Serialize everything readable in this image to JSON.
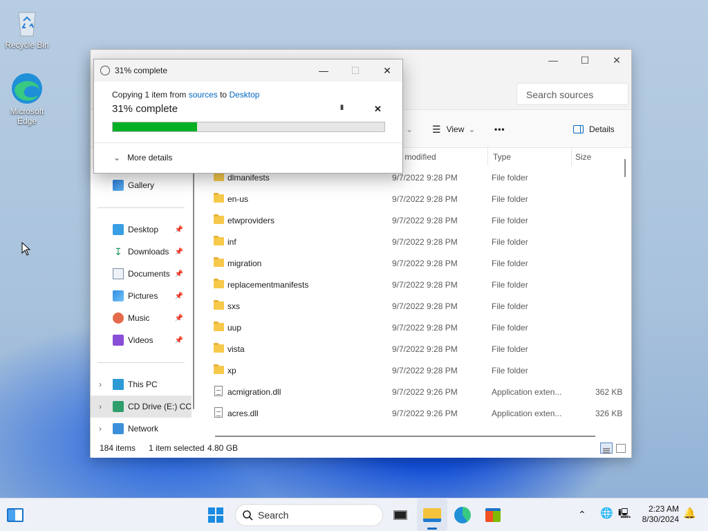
{
  "desktop": {
    "icons": [
      {
        "label": "Recycle Bin",
        "icon": "recycle-bin-icon"
      },
      {
        "label": "Microsoft Edge",
        "icon": "edge-icon"
      }
    ]
  },
  "explorer": {
    "search_placeholder": "Search sources",
    "toolbar": {
      "view_label": "View",
      "more_label": "•••",
      "details_label": "Details"
    },
    "columns": [
      "te modified",
      "Type",
      "Size"
    ],
    "sidebar": {
      "gallery": "Gallery",
      "quick_access": [
        {
          "label": "Desktop",
          "icon": "desktop-icon"
        },
        {
          "label": "Downloads",
          "icon": "downloads-icon"
        },
        {
          "label": "Documents",
          "icon": "documents-icon"
        },
        {
          "label": "Pictures",
          "icon": "pictures-icon"
        },
        {
          "label": "Music",
          "icon": "music-icon"
        },
        {
          "label": "Videos",
          "icon": "videos-icon"
        }
      ],
      "this_pc": "This PC",
      "cd_drive": "CD Drive (E:) CC",
      "network": "Network"
    },
    "files": [
      {
        "name": "dlmanifests",
        "date": "9/7/2022 9:28 PM",
        "type": "File folder",
        "size": "",
        "kind": "folder"
      },
      {
        "name": "en-us",
        "date": "9/7/2022 9:28 PM",
        "type": "File folder",
        "size": "",
        "kind": "folder"
      },
      {
        "name": "etwproviders",
        "date": "9/7/2022 9:28 PM",
        "type": "File folder",
        "size": "",
        "kind": "folder"
      },
      {
        "name": "inf",
        "date": "9/7/2022 9:28 PM",
        "type": "File folder",
        "size": "",
        "kind": "folder"
      },
      {
        "name": "migration",
        "date": "9/7/2022 9:28 PM",
        "type": "File folder",
        "size": "",
        "kind": "folder"
      },
      {
        "name": "replacementmanifests",
        "date": "9/7/2022 9:28 PM",
        "type": "File folder",
        "size": "",
        "kind": "folder"
      },
      {
        "name": "sxs",
        "date": "9/7/2022 9:28 PM",
        "type": "File folder",
        "size": "",
        "kind": "folder"
      },
      {
        "name": "uup",
        "date": "9/7/2022 9:28 PM",
        "type": "File folder",
        "size": "",
        "kind": "folder"
      },
      {
        "name": "vista",
        "date": "9/7/2022 9:28 PM",
        "type": "File folder",
        "size": "",
        "kind": "folder"
      },
      {
        "name": "xp",
        "date": "9/7/2022 9:28 PM",
        "type": "File folder",
        "size": "",
        "kind": "folder"
      },
      {
        "name": "acmigration.dll",
        "date": "9/7/2022 9:26 PM",
        "type": "Application exten...",
        "size": "362 KB",
        "kind": "dll"
      },
      {
        "name": "acres.dll",
        "date": "9/7/2022 9:26 PM",
        "type": "Application exten...",
        "size": "326 KB",
        "kind": "dll"
      }
    ],
    "status": {
      "count": "184 items",
      "selected": "1 item selected",
      "size": "4.80 GB"
    }
  },
  "copy_dialog": {
    "title": "31% complete",
    "copying_prefix": "Copying 1 item from",
    "source": "sources",
    "to": "to",
    "destination": "Desktop",
    "progress_text": "31% complete",
    "progress_percent": 31,
    "pause_label": "II",
    "cancel_label": "✕",
    "more_details": "More details"
  },
  "taskbar": {
    "search_placeholder": "Search",
    "time": "2:23 AM",
    "date": "8/30/2024"
  },
  "colors": {
    "progress_fill": "#06b025",
    "accent": "#0067c0"
  }
}
